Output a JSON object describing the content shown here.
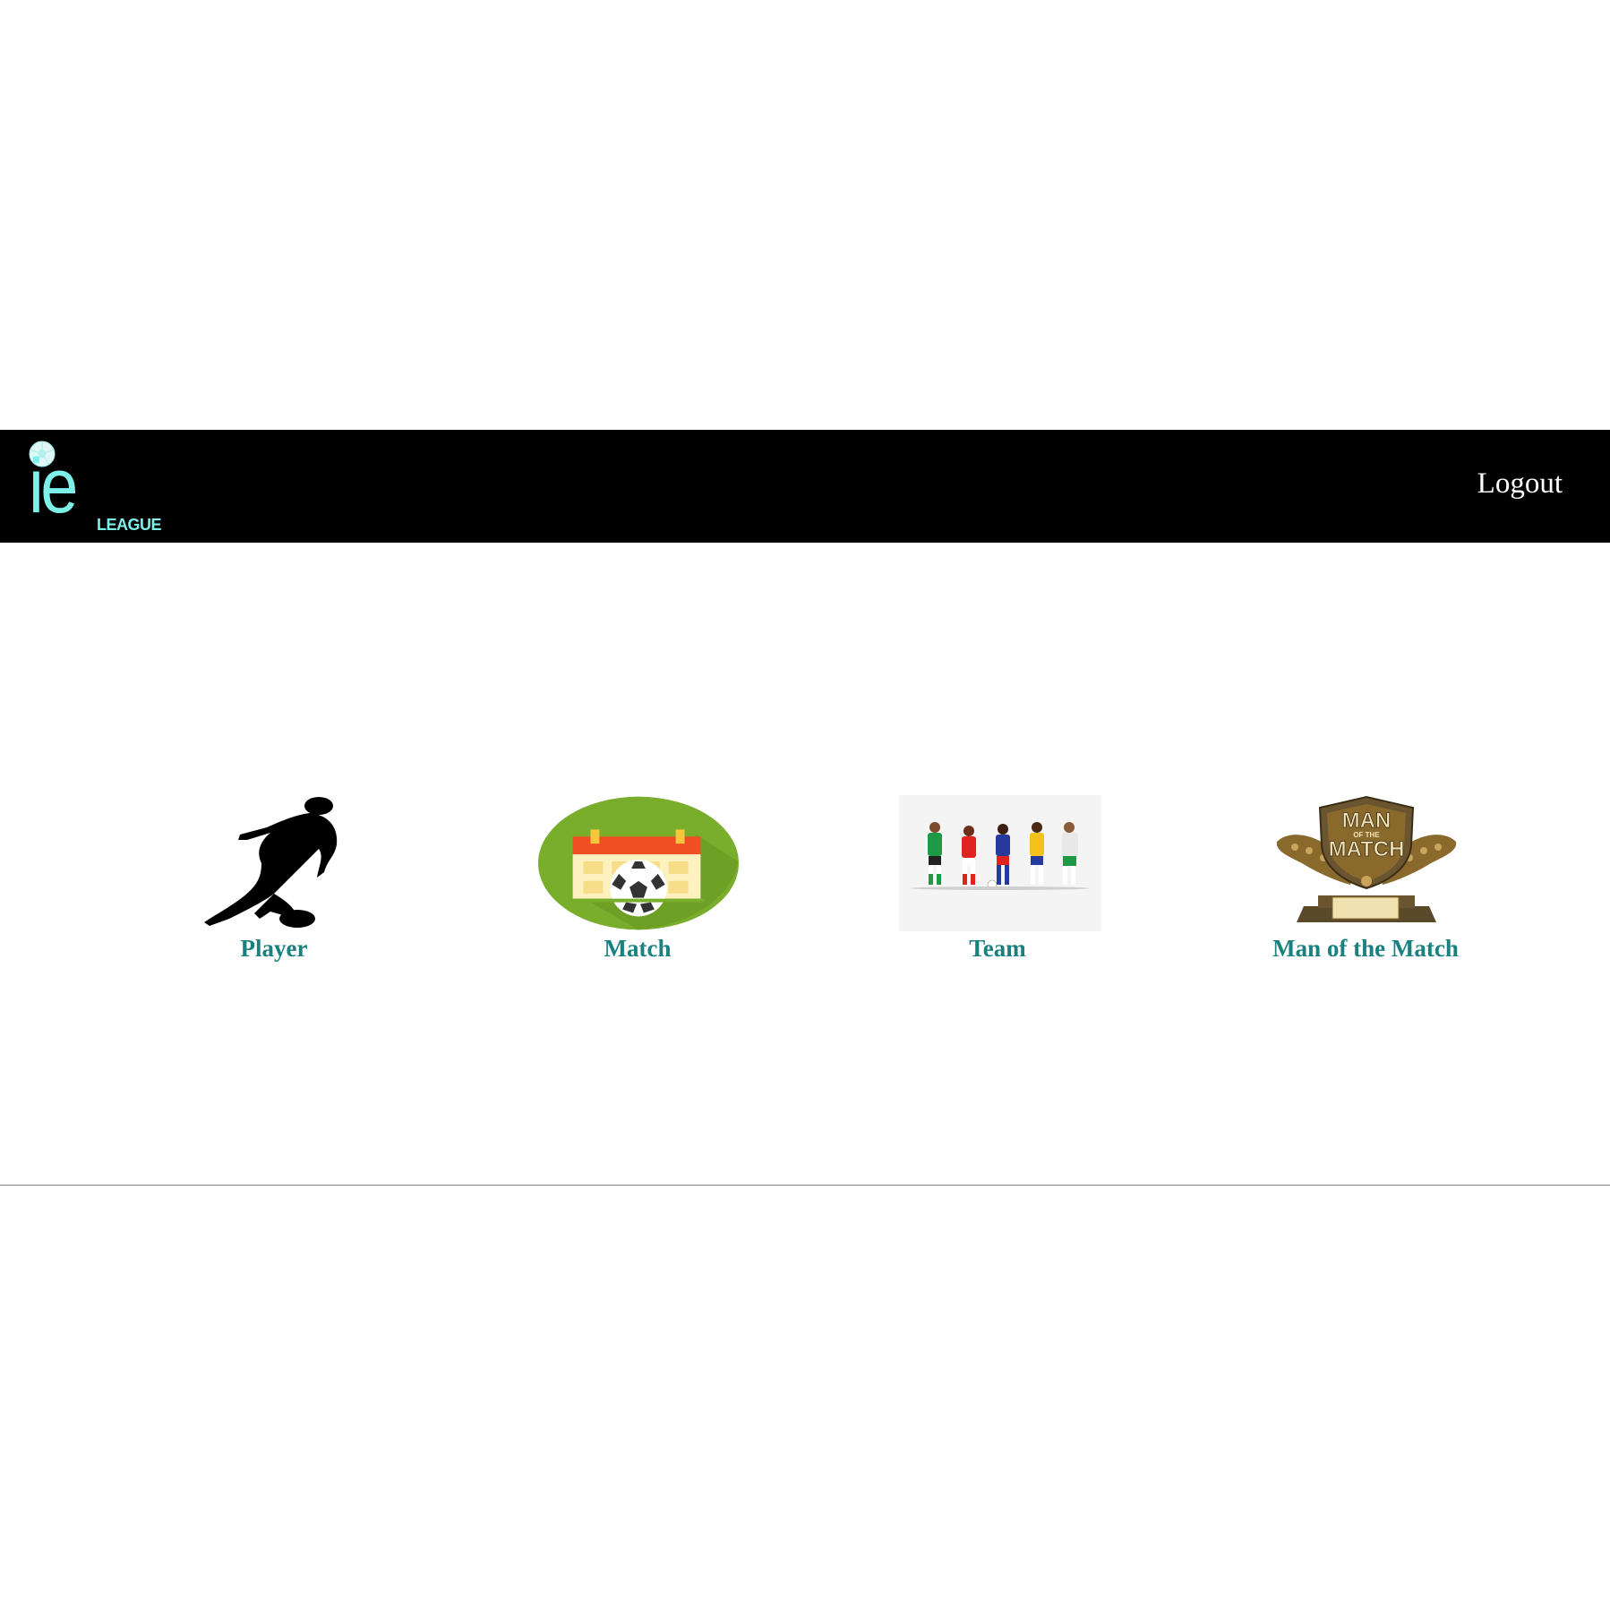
{
  "header": {
    "logo": {
      "main_text": "ie",
      "sub_text": "LEAGUE",
      "icon": "soccer-ball-icon",
      "color": "#7ef0ea"
    },
    "logout_label": "Logout",
    "background": "#000000"
  },
  "tiles": [
    {
      "label": "Player",
      "icon": "player-silhouette-icon"
    },
    {
      "label": "Match",
      "icon": "match-calendar-icon"
    },
    {
      "label": "Team",
      "icon": "team-players-icon"
    },
    {
      "label": "Man of the Match",
      "icon": "trophy-icon",
      "image_text_top": "MAN",
      "image_text_mid": "OF THE",
      "image_text_bottom": "MATCH"
    }
  ],
  "colors": {
    "label": "#1b8080",
    "match_green": "#79ad2c",
    "calendar_red": "#f04e23",
    "trophy_bronze": "#8a6a2c"
  }
}
